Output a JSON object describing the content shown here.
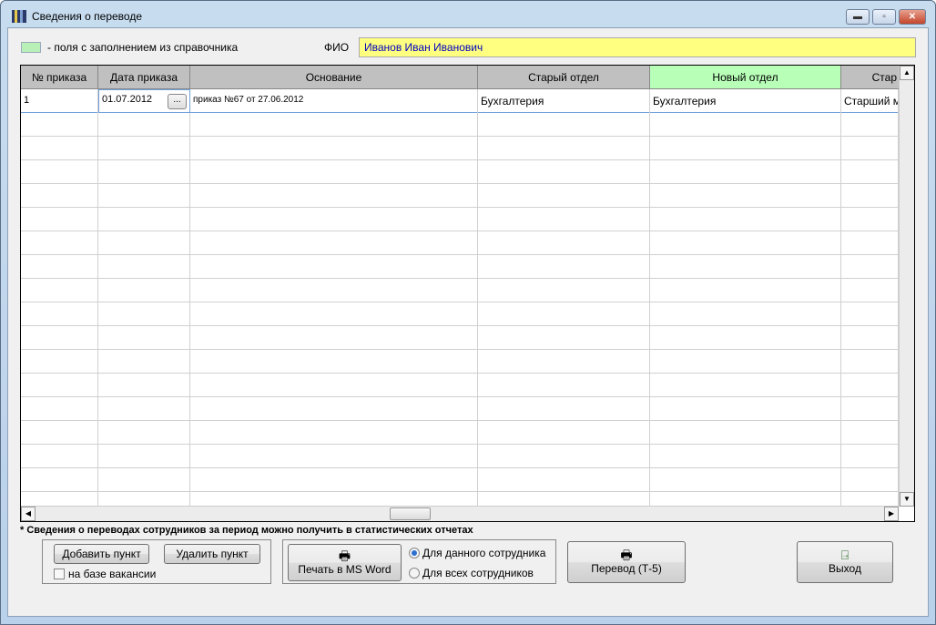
{
  "window": {
    "title": "Сведения о переводе"
  },
  "legend": {
    "text": "- поля с заполнением из справочника",
    "swatch_color": "#b8f0b8"
  },
  "fio": {
    "label": "ФИО",
    "value": "Иванов Иван Иванович"
  },
  "grid": {
    "columns": [
      "№ приказа",
      "Дата приказа",
      "Основание",
      "Старый отдел",
      "Новый отдел",
      "Стар"
    ],
    "rows": [
      {
        "num": "1",
        "date": "01.07.2012",
        "date_button": "...",
        "basis": "приказ №67 от 27.06.2012",
        "old_dept": "Бухгалтерия",
        "new_dept": "Бухгалтерия",
        "old_pos": "Старший м"
      }
    ]
  },
  "note": "* Сведения о переводах сотрудников за период можно получить в статистических отчетах",
  "buttons": {
    "add": "Добавить пункт",
    "delete": "Удалить пункт",
    "vacancy": "на базе вакансии",
    "print_word": "Печать в MS Word",
    "this_employee": "Для данного сотрудника",
    "all_employees": "Для всех сотрудников",
    "transfer": "Перевод (Т-5)",
    "exit": "Выход"
  },
  "state": {
    "vacancy_checked": false,
    "print_scope": "Для данного сотрудника"
  }
}
